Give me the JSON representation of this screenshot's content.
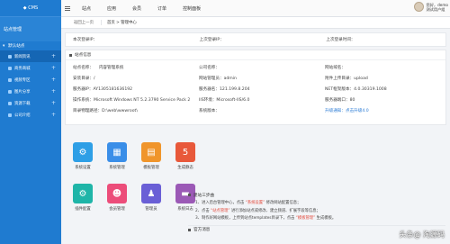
{
  "sidebar": {
    "title": "站点管理",
    "group": "默认站点",
    "items": [
      {
        "label": "新闻资讯",
        "icon": "news-icon"
      },
      {
        "label": "商务商城",
        "icon": "shop-icon"
      },
      {
        "label": "视频专区",
        "icon": "video-icon"
      },
      {
        "label": "图片分享",
        "icon": "image-icon"
      },
      {
        "label": "资源下载",
        "icon": "download-icon"
      },
      {
        "label": "公司介绍",
        "icon": "company-icon"
      }
    ]
  },
  "topbar": {
    "tabs": [
      "站点",
      "应用",
      "会员",
      "订单",
      "控制面板"
    ],
    "user_line1": "您好，demo",
    "user_line2": "测试用户组"
  },
  "tabbar": {
    "back": "返回上一页",
    "current": "首页 > 管理中心"
  },
  "login": {
    "this_time": "本次登录IP：",
    "last_time": "上次登录IP：",
    "last_login": "上次登录时间："
  },
  "info": {
    "header": "站点信息",
    "rows": [
      [
        "站点名称：",
        "内容管理系统",
        "公司名称：",
        "",
        "网站域名："
      ],
      [
        "安装目录：/",
        "",
        "网站管理员：admin",
        "",
        "附件上传目录：upload"
      ],
      [
        "服务器IP：AY1305181636192",
        "",
        "服务器名：121.199.8.204",
        "",
        "NET框架版本：4.0.30319.1008"
      ],
      [
        "操作系统：Microsoft Windows NT 5.2.3790 Service Pack 2",
        "",
        "IIS环境：Microsoft-IIS/6.0",
        "",
        "服务器端口：80"
      ],
      [
        "目录物理路径：D:\\web\\wwwroot\\",
        "",
        "系统版本：",
        "",
        "升级通知：点击升级4.0"
      ]
    ]
  },
  "icons": [
    {
      "label": "系统设置",
      "color": "#2e9fe6",
      "glyph": "⚙",
      "icon": "gear-icon"
    },
    {
      "label": "系统管理",
      "color": "#3a8ee8",
      "glyph": "▦",
      "icon": "grid-icon"
    },
    {
      "label": "模板管理",
      "color": "#f0952b",
      "glyph": "▤",
      "icon": "template-icon"
    },
    {
      "label": "生成静态",
      "color": "#e8593b",
      "glyph": "5",
      "icon": "html5-icon"
    },
    {
      "label": "插件配置",
      "color": "#1fb5a8",
      "glyph": "⚙",
      "icon": "plugin-icon"
    },
    {
      "label": "会员管理",
      "color": "#ec4d7a",
      "glyph": "☻",
      "icon": "member-icon"
    },
    {
      "label": "管理员",
      "color": "#6a5fd6",
      "glyph": "♟",
      "icon": "admin-icon"
    },
    {
      "label": "系统日志",
      "color": "#9b59b6",
      "glyph": "▬",
      "icon": "log-icon"
    }
  ],
  "notice": {
    "header": "建站三步曲",
    "lines": [
      {
        "pre": "1、进入后台管理中心，点击 ",
        "key": "“系统设置”",
        "post": " 修改网站配置信息；"
      },
      {
        "pre": "2、点击 ",
        "key": "“站点管理”",
        "post": " 进行添加站点或修改、建立频道、扩展字段等信息；"
      },
      {
        "pre": "3、制作好网站模板，上传到站点templates目录下，点击 ",
        "key": "“模板管理”",
        "post": " 生成模板。"
      }
    ],
    "footer_header": "官方消息"
  },
  "watermark": "头条@ 淘源码"
}
